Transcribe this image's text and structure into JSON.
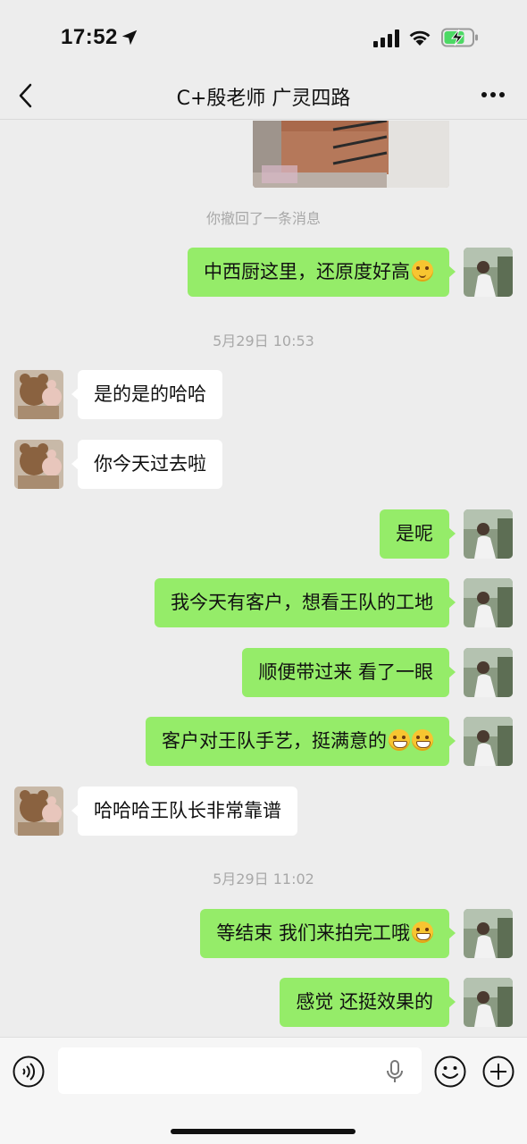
{
  "status_bar": {
    "time": "17:52"
  },
  "nav": {
    "title": "C+殷老师 广灵四路"
  },
  "messages": {
    "system_recall": "你撤回了一条消息",
    "ts1": "5月29日 10:53",
    "ts2": "5月29日 11:02",
    "m1": "中西厨这里，还原度好高",
    "m2": "是的是的哈哈",
    "m3": "你今天过去啦",
    "m4": "是呢",
    "m5": "我今天有客户，想看王队的工地",
    "m6": "顺便带过来 看了一眼",
    "m7": "客户对王队手艺，挺满意的",
    "m8": "哈哈哈王队长非常靠谱",
    "m9": "等结束 我们来拍完工哦",
    "m10": "感觉 还挺效果的"
  },
  "input": {
    "value": "",
    "placeholder": ""
  },
  "icons": {
    "back": "chevron-left-icon",
    "more": "more-icon",
    "voice": "voice-icon",
    "mic": "mic-icon",
    "emoji": "emoji-icon",
    "plus": "plus-icon"
  },
  "colors": {
    "background": "#ededed",
    "outgoing_bubble": "#95ec69",
    "incoming_bubble": "#ffffff",
    "system_text": "#a8a8a8"
  }
}
